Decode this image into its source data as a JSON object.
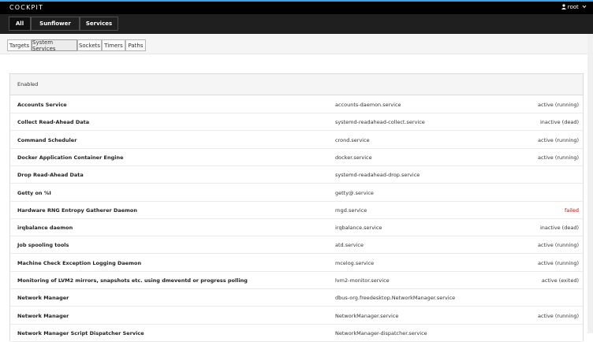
{
  "header": {
    "brand": "COCKPIT",
    "user": "root",
    "user_icon": "person-icon",
    "caret_icon": "chevron-down-icon",
    "accent_color": "#39a5dc"
  },
  "nav": {
    "buttons": [
      {
        "label": "All"
      },
      {
        "label": "Sunflower"
      },
      {
        "label": "Services"
      }
    ]
  },
  "tabs": [
    {
      "label": "Targets"
    },
    {
      "label": "System Services"
    },
    {
      "label": "Sockets"
    },
    {
      "label": "Timers"
    },
    {
      "label": "Paths"
    }
  ],
  "panel": {
    "title": "Enabled",
    "rows": [
      {
        "description": "Accounts Service",
        "unit": "accounts-daemon.service",
        "state": "active (running)"
      },
      {
        "description": "Collect Read-Ahead Data",
        "unit": "systemd-readahead-collect.service",
        "state": "inactive (dead)"
      },
      {
        "description": "Command Scheduler",
        "unit": "crond.service",
        "state": "active (running)"
      },
      {
        "description": "Docker Application Container Engine",
        "unit": "docker.service",
        "state": "active (running)"
      },
      {
        "description": "Drop Read-Ahead Data",
        "unit": "systemd-readahead-drop.service",
        "state": ""
      },
      {
        "description": "Getty on %I",
        "unit": "getty@.service",
        "state": ""
      },
      {
        "description": "Hardware RNG Entropy Gatherer Daemon",
        "unit": "rngd.service",
        "state": "failed"
      },
      {
        "description": "irqbalance daemon",
        "unit": "irqbalance.service",
        "state": "inactive (dead)"
      },
      {
        "description": "Job spooling tools",
        "unit": "atd.service",
        "state": "active (running)"
      },
      {
        "description": "Machine Check Exception Logging Daemon",
        "unit": "mcelog.service",
        "state": "active (running)"
      },
      {
        "description": "Monitoring of LVM2 mirrors, snapshots etc. using dmeventd or progress polling",
        "unit": "lvm2-monitor.service",
        "state": "active (exited)"
      },
      {
        "description": "Network Manager",
        "unit": "dbus-org.freedesktop.NetworkManager.service",
        "state": ""
      },
      {
        "description": "Network Manager",
        "unit": "NetworkManager.service",
        "state": "active (running)"
      },
      {
        "description": "Network Manager Script Dispatcher Service",
        "unit": "NetworkManager-dispatcher.service",
        "state": ""
      }
    ]
  },
  "colors": {
    "failed": "#cc0000"
  }
}
